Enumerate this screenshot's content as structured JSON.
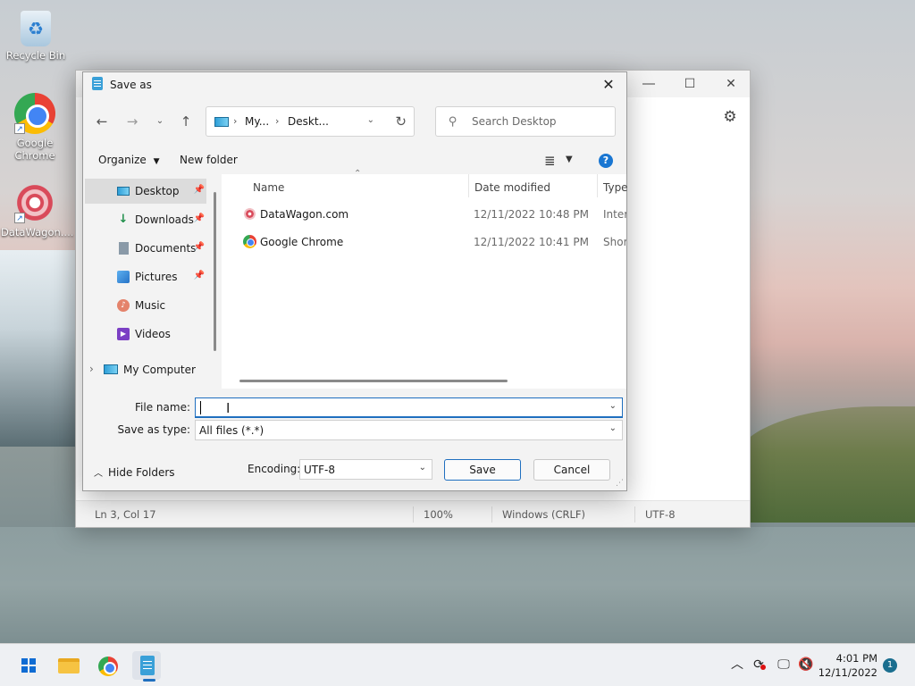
{
  "desktop": {
    "icons": [
      {
        "label": "Recycle Bin"
      },
      {
        "label": "Google Chrome"
      },
      {
        "label": "DataWagon...."
      }
    ]
  },
  "notepad": {
    "status": {
      "position": "Ln 3, Col 17",
      "zoom": "100%",
      "line_endings": "Windows (CRLF)",
      "encoding": "UTF-8"
    }
  },
  "dialog": {
    "title": "Save as",
    "address": {
      "crumbs": [
        "My...",
        "Deskt..."
      ]
    },
    "search": {
      "placeholder": "Search Desktop"
    },
    "toolbar": {
      "organize": "Organize",
      "new_folder": "New folder",
      "help": "?"
    },
    "nav": [
      {
        "label": "Desktop",
        "icon": "desktop-icon",
        "pinned": true,
        "selected": true
      },
      {
        "label": "Downloads",
        "icon": "download-icon",
        "pinned": true
      },
      {
        "label": "Documents",
        "icon": "documents-icon",
        "pinned": true
      },
      {
        "label": "Pictures",
        "icon": "pictures-icon",
        "pinned": true
      },
      {
        "label": "Music",
        "icon": "music-icon"
      },
      {
        "label": "Videos",
        "icon": "videos-icon"
      },
      {
        "label": "My Computer",
        "icon": "computer-icon"
      }
    ],
    "columns": {
      "name": "Name",
      "date": "Date modified",
      "type": "Type"
    },
    "files": [
      {
        "name": "DataWagon.com",
        "date": "12/11/2022 10:48 PM",
        "type": "Internet Shortcut"
      },
      {
        "name": "Google Chrome",
        "date": "12/11/2022 10:41 PM",
        "type": "Shortcut"
      }
    ],
    "file_name": {
      "label": "File name:",
      "value": ""
    },
    "save_type": {
      "label": "Save as type:",
      "value": "All files  (*.*)"
    },
    "hide_folders": "Hide Folders",
    "encoding": {
      "label": "Encoding:",
      "value": "UTF-8"
    },
    "save_label": "Save",
    "cancel_label": "Cancel"
  },
  "taskbar": {
    "clock": {
      "time": "4:01 PM",
      "date": "12/11/2022"
    },
    "notifications": "1"
  },
  "colors": {
    "accent": "#1f6fbf",
    "selected_nav": "#dcdcdc"
  }
}
